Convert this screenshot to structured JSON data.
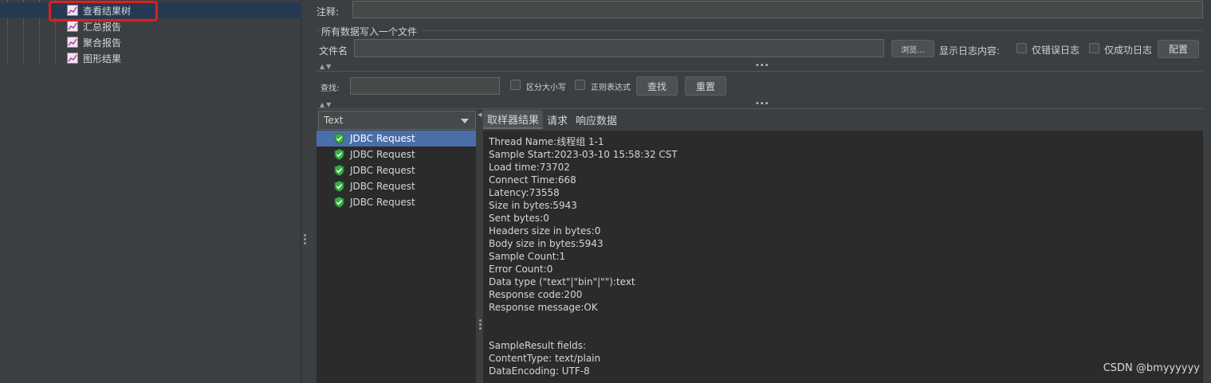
{
  "tree": {
    "items": [
      {
        "label": "查看结果树",
        "selected": true
      },
      {
        "label": "汇总报告",
        "selected": false
      },
      {
        "label": "聚合报告",
        "selected": false
      },
      {
        "label": "图形结果",
        "selected": false
      }
    ]
  },
  "form": {
    "comment_label": "注释:",
    "comment_value": "",
    "file_section_title": "所有数据写入一个文件",
    "filename_label": "文件名",
    "filename_value": "",
    "browse_label": "浏览...",
    "log_display_label": "显示日志内容:",
    "errors_only_label": "仅错误日志",
    "success_only_label": "仅成功日志",
    "configure_label": "配置"
  },
  "search": {
    "label": "查找:",
    "value": "",
    "case_sensitive_label": "区分大小写",
    "regex_label": "正则表达式",
    "find_button": "查找",
    "reset_button": "重置"
  },
  "results": {
    "renderer_selected": "Text",
    "items": [
      {
        "label": "JDBC Request",
        "selected": true
      },
      {
        "label": "JDBC Request",
        "selected": false
      },
      {
        "label": "JDBC Request",
        "selected": false
      },
      {
        "label": "JDBC Request",
        "selected": false
      },
      {
        "label": "JDBC Request",
        "selected": false
      }
    ]
  },
  "detail": {
    "tabs": [
      "取样器结果",
      "请求",
      "响应数据"
    ],
    "active_tab": "取样器结果",
    "lines": [
      "Thread Name:线程组 1-1",
      "Sample Start:2023-03-10 15:58:32 CST",
      "Load time:73702",
      "Connect Time:668",
      "Latency:73558",
      "Size in bytes:5943",
      "Sent bytes:0",
      "Headers size in bytes:0",
      "Body size in bytes:5943",
      "Sample Count:1",
      "Error Count:0",
      "Data type (\"text\"|\"bin\"|\"\"):text",
      "Response code:200",
      "Response message:OK",
      "",
      "",
      "SampleResult fields:",
      "ContentType: text/plain",
      "DataEncoding: UTF-8"
    ]
  },
  "watermark": "CSDN @bmyyyyyy",
  "colors": {
    "background": "#3c3f41",
    "panel_dark": "#2b2b2b",
    "selection": "#4a6ea8",
    "highlight_box": "#e21d1d",
    "success_icon": "#3cb043"
  }
}
